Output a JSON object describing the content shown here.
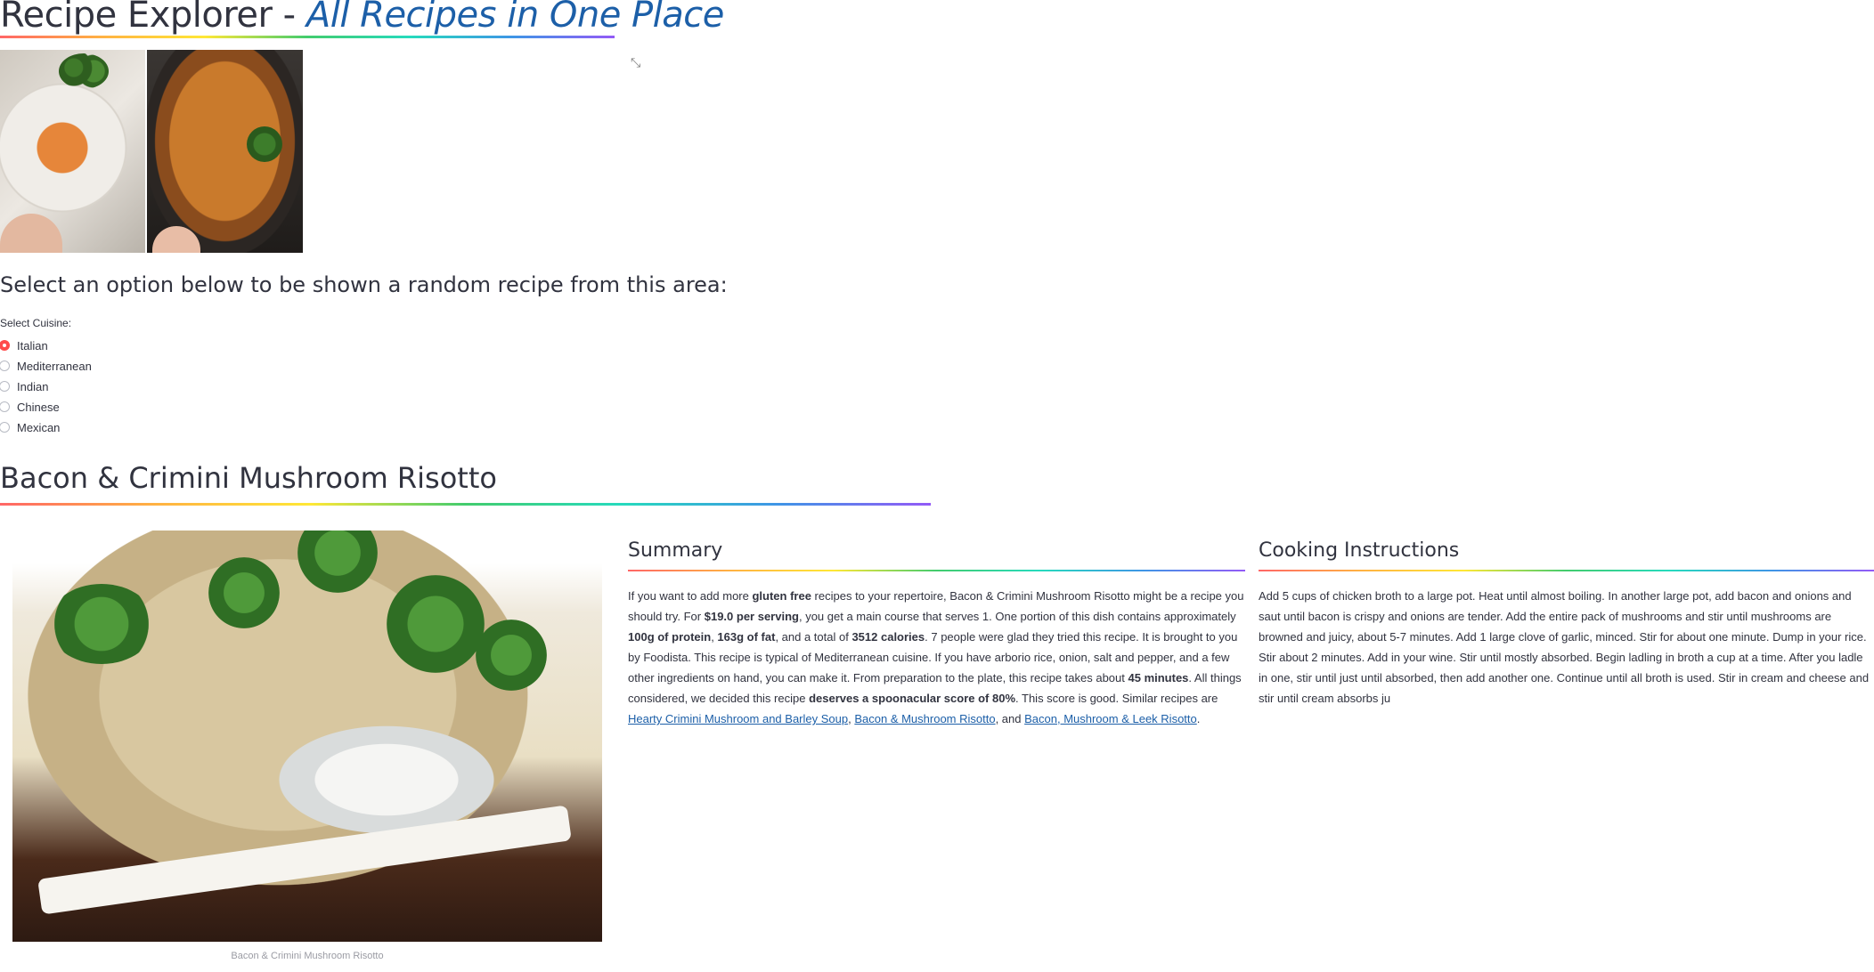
{
  "header": {
    "title_main": "Recipe Explorer - ",
    "title_sub": "All Recipes in One Place"
  },
  "icons": {
    "expand": "expand-icon"
  },
  "prompt": "Select an option below to be shown a random recipe from this area:",
  "cuisine": {
    "label": "Select Cuisine:",
    "options": [
      "Italian",
      "Mediterranean",
      "Indian",
      "Chinese",
      "Mexican"
    ],
    "selected": "Italian"
  },
  "recipe": {
    "title": "Bacon & Crimini Mushroom Risotto",
    "image_caption": "Bacon & Crimini Mushroom Risotto",
    "summary_heading": "Summary",
    "summary": {
      "t1": "If you want to add more ",
      "b1": "gluten free",
      "t2": " recipes to your repertoire, Bacon & Crimini Mushroom Risotto might be a recipe you should try. For ",
      "b2": "$19.0 per serving",
      "t3": ", you get a main course that serves 1. One portion of this dish contains approximately ",
      "b3": "100g of protein",
      "t4": ", ",
      "b4": "163g of fat",
      "t5": ", and a total of ",
      "b5": "3512 calories",
      "t6": ". 7 people were glad they tried this recipe. It is brought to you by Foodista. This recipe is typical of Mediterranean cuisine. If you have arborio rice, onion, salt and pepper, and a few other ingredients on hand, you can make it. From preparation to the plate, this recipe takes about ",
      "b6": "45 minutes",
      "t7": ". All things considered, we decided this recipe ",
      "b7": "deserves a spoonacular score of 80%",
      "t8": ". This score is good. Similar recipes are ",
      "l1": "Hearty Crimini Mushroom and Barley Soup",
      "t9": ", ",
      "l2": "Bacon & Mushroom Risotto",
      "t10": ", and ",
      "l3": "Bacon, Mushroom & Leek Risotto",
      "t11": "."
    },
    "instructions_heading": "Cooking Instructions",
    "instructions": "Add 5 cups of chicken broth to a large pot. Heat until almost boiling. In another large pot, add bacon and onions and saut until bacon is crispy and onions are tender. Add the entire pack of mushrooms and stir until mushrooms are browned and juicy, about 5-7 minutes. Add 1 large clove of garlic, minced. Stir for about one minute. Dump in your rice. Stir about 2 minutes. Add in your wine. Stir until mostly absorbed. Begin ladling in broth a cup at a time. After you ladle in one, stir until just until absorbed, then add another one. Continue until all broth is used. Stir in cream and cheese and stir until cream absorbs ju"
  }
}
